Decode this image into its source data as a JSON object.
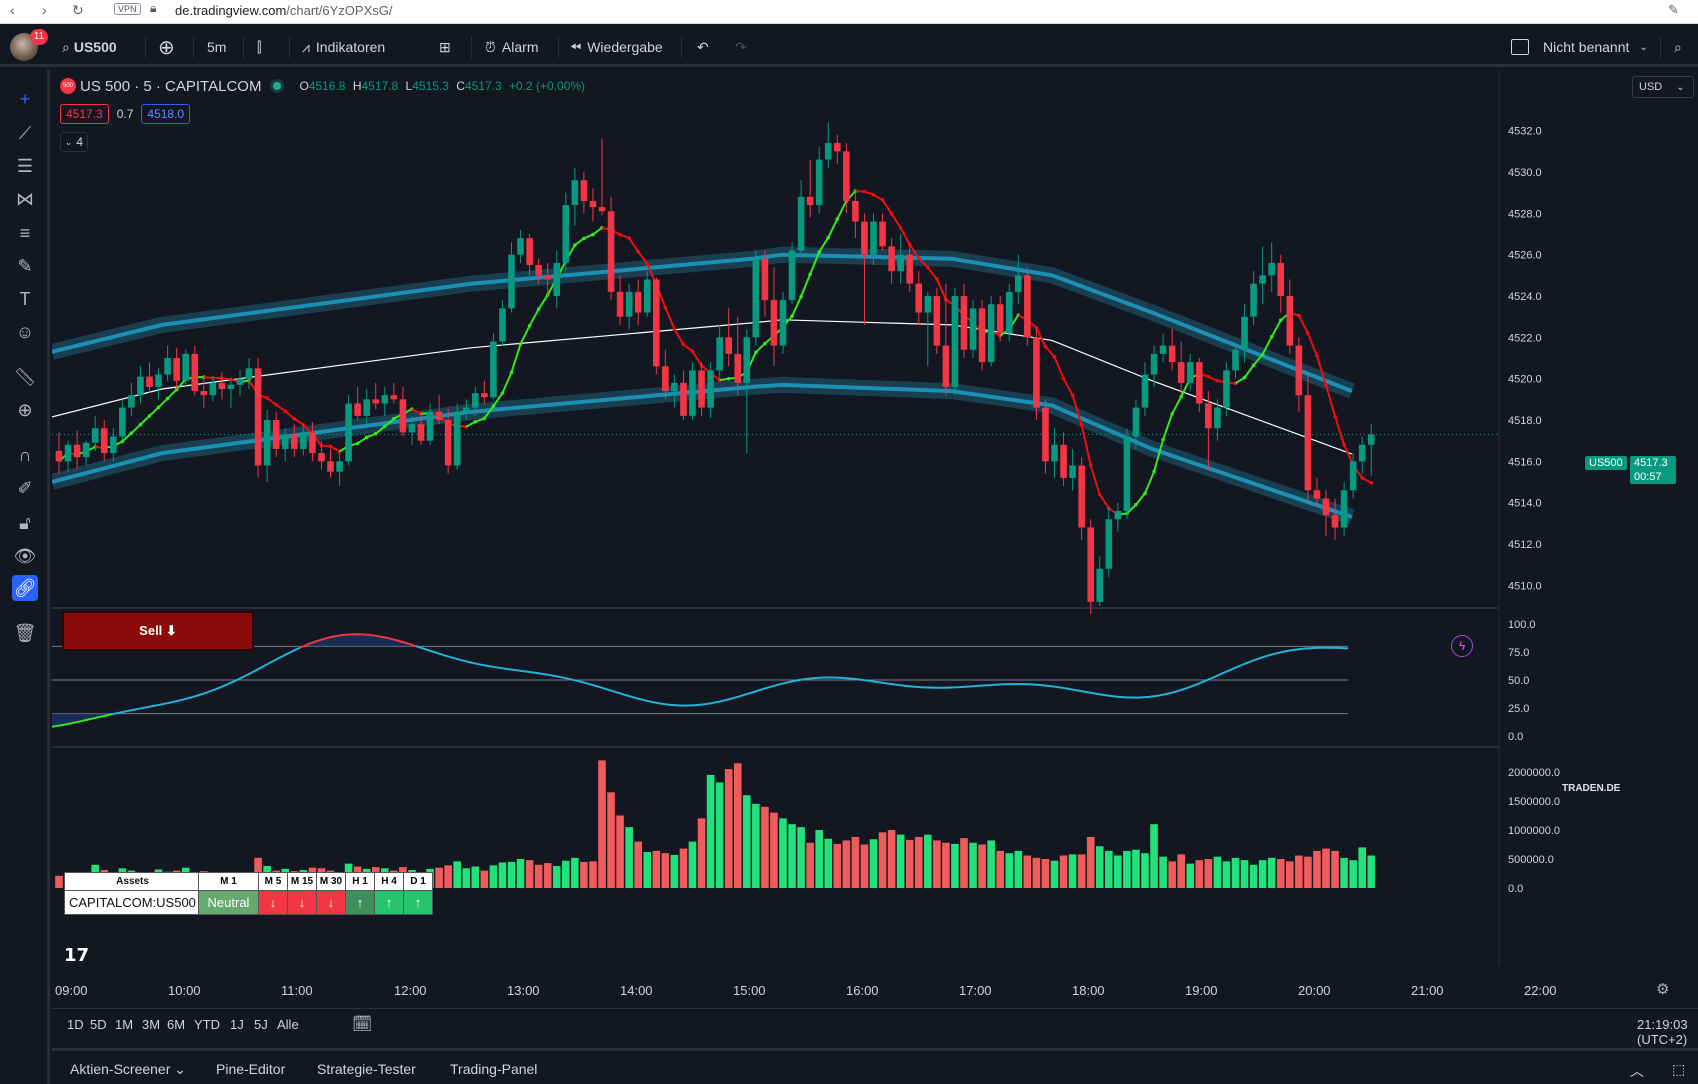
{
  "browser": {
    "url_host": "de.tradingview.com",
    "url_path": "/chart/6YzOPXsG/",
    "vpn_label": "VPN"
  },
  "toolbar": {
    "notifications": "11",
    "symbol": "US500",
    "interval": "5m",
    "indicators": "Indikatoren",
    "alarm": "Alarm",
    "replay": "Wiedergabe",
    "layout_name": "Nicht benannt"
  },
  "left_tools": [
    "crosshair-icon",
    "trend-line-icon",
    "horizontal-lines-icon",
    "pattern-icon",
    "fib-icon",
    "brush-icon",
    "text-icon",
    "emoji-icon",
    "ruler-icon",
    "zoom-icon",
    "magnet-icon",
    "lock-drawing-icon",
    "lock-icon",
    "eye-icon",
    "link-icon",
    "trash-icon"
  ],
  "legend": {
    "logo_text": "500",
    "title": "US 500 · 5 · CAPITALCOM",
    "o_label": "O",
    "o": "4516.8",
    "h_label": "H",
    "h": "4517.8",
    "l_label": "L",
    "l": "4515.3",
    "c_label": "C",
    "c": "4517.3",
    "change": "+0.2 (+0.00%)",
    "bid": "4517.3",
    "spread": "0.7",
    "ask": "4518.0",
    "collapse_count": "4",
    "currency": "USD"
  },
  "sell_button": "Sell ⬇",
  "price_tag": {
    "symbol": "US500",
    "price": "4517.3",
    "countdown": "00:57"
  },
  "price_axis": [
    "4532.0",
    "4530.0",
    "4528.0",
    "4526.0",
    "4524.0",
    "4522.0",
    "4520.0",
    "4518.0",
    "4516.0",
    "4514.0",
    "4512.0",
    "4510.0"
  ],
  "osc_axis": [
    "100.0",
    "75.0",
    "50.0",
    "25.0",
    "0.0"
  ],
  "vol_axis": [
    "2000000.0",
    "1500000.0",
    "1000000.0",
    "500000.0",
    "0.0"
  ],
  "osc_brand": "TRADEN.DE",
  "mtf_table": {
    "header": [
      "Assets",
      "M 1",
      "M 5",
      "M 15",
      "M 30",
      "H 1",
      "H 4",
      "D 1"
    ],
    "asset": "CAPITALCOM:US500",
    "m1": "Neutral",
    "arrows": [
      "↓",
      "↓",
      "↓",
      "↑",
      "↑",
      "↑"
    ]
  },
  "time_axis": [
    "09:00",
    "10:00",
    "11:00",
    "12:00",
    "13:00",
    "14:00",
    "15:00",
    "16:00",
    "17:00",
    "18:00",
    "19:00",
    "20:00",
    "21:00",
    "22:00"
  ],
  "ranges": [
    "1D",
    "5D",
    "1M",
    "3M",
    "6M",
    "YTD",
    "1J",
    "5J",
    "Alle"
  ],
  "clock": "21:19:03 (UTC+2)",
  "bottom_panels": [
    "Aktien-Screener",
    "Pine-Editor",
    "Strategie-Tester",
    "Trading-Panel"
  ],
  "chart_data": {
    "type": "candlestick",
    "price_range": [
      4509.0,
      4533.0
    ],
    "candles": [
      [
        4516.5,
        4517.4,
        4515.4,
        4516.0
      ],
      [
        4516.0,
        4517.0,
        4515.5,
        4516.8
      ],
      [
        4516.8,
        4517.5,
        4515.6,
        4516.2
      ],
      [
        4516.2,
        4517.0,
        4515.8,
        4516.9
      ],
      [
        4516.9,
        4518.2,
        4516.5,
        4517.6
      ],
      [
        4517.6,
        4518.0,
        4516.0,
        4516.4
      ],
      [
        4516.4,
        4517.6,
        4516.0,
        4517.2
      ],
      [
        4517.2,
        4519.0,
        4517.0,
        4518.6
      ],
      [
        4518.6,
        4519.8,
        4518.2,
        4519.2
      ],
      [
        4519.2,
        4520.6,
        4518.8,
        4520.1
      ],
      [
        4520.1,
        4520.8,
        4519.3,
        4519.6
      ],
      [
        4519.6,
        4520.5,
        4519.0,
        4520.2
      ],
      [
        4520.2,
        4521.6,
        4519.9,
        4521.0
      ],
      [
        4521.0,
        4521.5,
        4519.5,
        4519.9
      ],
      [
        4519.9,
        4521.4,
        4519.6,
        4521.2
      ],
      [
        4521.2,
        4521.6,
        4519.2,
        4519.4
      ],
      [
        4519.4,
        4520.0,
        4518.6,
        4519.2
      ],
      [
        4519.2,
        4520.1,
        4518.9,
        4519.8
      ],
      [
        4519.8,
        4520.3,
        4519.0,
        4519.5
      ],
      [
        4519.5,
        4520.0,
        4518.6,
        4519.7
      ],
      [
        4519.7,
        4520.4,
        4519.2,
        4520.0
      ],
      [
        4520.0,
        4521.0,
        4519.5,
        4520.5
      ],
      [
        4520.5,
        4521.0,
        4515.2,
        4515.8
      ],
      [
        4515.8,
        4518.5,
        4515.0,
        4518.0
      ],
      [
        4518.0,
        4518.4,
        4516.2,
        4516.6
      ],
      [
        4516.6,
        4517.6,
        4516.0,
        4517.3
      ],
      [
        4517.3,
        4517.8,
        4516.2,
        4516.6
      ],
      [
        4516.6,
        4517.8,
        4516.3,
        4517.4
      ],
      [
        4517.4,
        4517.9,
        4516.0,
        4516.4
      ],
      [
        4516.4,
        4517.0,
        4515.6,
        4516.0
      ],
      [
        4516.0,
        4516.6,
        4515.2,
        4515.5
      ],
      [
        4515.5,
        4516.4,
        4514.8,
        4516.0
      ],
      [
        4516.0,
        4519.2,
        4515.8,
        4518.8
      ],
      [
        4518.8,
        4519.6,
        4518.0,
        4518.2
      ],
      [
        4518.2,
        4519.5,
        4517.8,
        4519.0
      ],
      [
        4519.0,
        4519.8,
        4518.5,
        4518.8
      ],
      [
        4518.8,
        4519.6,
        4518.2,
        4519.2
      ],
      [
        4519.2,
        4519.8,
        4518.8,
        4519.0
      ],
      [
        4519.0,
        4519.6,
        4517.2,
        4517.4
      ],
      [
        4517.4,
        4518.2,
        4516.8,
        4517.8
      ],
      [
        4517.8,
        4518.3,
        4516.8,
        4517.0
      ],
      [
        4517.0,
        4518.8,
        4516.8,
        4518.4
      ],
      [
        4518.4,
        4519.2,
        4517.8,
        4518.0
      ],
      [
        4518.0,
        4518.6,
        4515.4,
        4515.8
      ],
      [
        4515.8,
        4518.8,
        4515.6,
        4518.4
      ],
      [
        4518.4,
        4519.0,
        4518.0,
        4518.6
      ],
      [
        4518.6,
        4519.6,
        4518.2,
        4519.3
      ],
      [
        4519.3,
        4519.9,
        4518.8,
        4519.1
      ],
      [
        4519.1,
        4522.2,
        4519.0,
        4521.8
      ],
      [
        4521.8,
        4523.8,
        4521.6,
        4523.4
      ],
      [
        4523.4,
        4526.6,
        4523.2,
        4526.0
      ],
      [
        4526.0,
        4527.2,
        4525.6,
        4526.8
      ],
      [
        4526.8,
        4527.0,
        4525.0,
        4525.5
      ],
      [
        4525.5,
        4525.8,
        4524.6,
        4525.0
      ],
      [
        4525.0,
        4525.6,
        4524.0,
        4524.8
      ],
      [
        4524.0,
        4526.2,
        4523.4,
        4525.6
      ],
      [
        4525.6,
        4529.0,
        4525.2,
        4528.4
      ],
      [
        4528.4,
        4530.2,
        4527.4,
        4529.6
      ],
      [
        4529.6,
        4530.0,
        4528.0,
        4528.6
      ],
      [
        4528.6,
        4529.2,
        4527.6,
        4528.3
      ],
      [
        4528.3,
        4531.6,
        4527.9,
        4528.1
      ],
      [
        4528.1,
        4528.8,
        4523.8,
        4524.2
      ],
      [
        4524.2,
        4525.0,
        4522.6,
        4523.0
      ],
      [
        4523.0,
        4524.6,
        4522.4,
        4524.2
      ],
      [
        4524.2,
        4524.8,
        4522.6,
        4523.2
      ],
      [
        4523.2,
        4525.2,
        4523.0,
        4524.8
      ],
      [
        4524.8,
        4524.9,
        4520.2,
        4520.6
      ],
      [
        4520.6,
        4521.4,
        4519.0,
        4519.4
      ],
      [
        4519.4,
        4520.2,
        4518.6,
        4519.8
      ],
      [
        4519.8,
        4520.4,
        4518.0,
        4518.2
      ],
      [
        4518.2,
        4520.8,
        4518.0,
        4520.4
      ],
      [
        4520.4,
        4520.8,
        4518.2,
        4518.6
      ],
      [
        4518.6,
        4520.8,
        4518.1,
        4520.4
      ],
      [
        4520.4,
        4522.6,
        4520.0,
        4522.0
      ],
      [
        4522.0,
        4523.4,
        4520.6,
        4521.2
      ],
      [
        4521.2,
        4523.0,
        4519.2,
        4519.8
      ],
      [
        4519.8,
        4522.4,
        4516.4,
        4522.0
      ],
      [
        4522.0,
        4526.2,
        4521.6,
        4525.8
      ],
      [
        4525.8,
        4526.2,
        4523.0,
        4523.8
      ],
      [
        4523.8,
        4525.4,
        4520.6,
        4521.6
      ],
      [
        4521.6,
        4524.2,
        4521.2,
        4523.8
      ],
      [
        4523.8,
        4526.6,
        4523.6,
        4526.2
      ],
      [
        4526.2,
        4529.6,
        4526.0,
        4528.8
      ],
      [
        4528.8,
        4530.6,
        4527.8,
        4528.4
      ],
      [
        4528.4,
        4531.2,
        4528.0,
        4530.6
      ],
      [
        4530.6,
        4532.4,
        4530.2,
        4531.4
      ],
      [
        4531.4,
        4531.8,
        4530.4,
        4531.0
      ],
      [
        4531.0,
        4531.4,
        4528.0,
        4528.6
      ],
      [
        4528.6,
        4529.0,
        4526.8,
        4527.6
      ],
      [
        4527.6,
        4528.0,
        4522.6,
        4526.0
      ],
      [
        4526.0,
        4528.0,
        4525.5,
        4527.6
      ],
      [
        4527.6,
        4528.0,
        4526.2,
        4526.4
      ],
      [
        4526.4,
        4526.8,
        4524.6,
        4525.2
      ],
      [
        4525.2,
        4527.0,
        4524.6,
        4526.0
      ],
      [
        4526.0,
        4526.4,
        4524.2,
        4524.6
      ],
      [
        4524.6,
        4525.2,
        4522.6,
        4523.2
      ],
      [
        4523.2,
        4524.2,
        4520.6,
        4524.0
      ],
      [
        4524.0,
        4524.4,
        4521.2,
        4521.6
      ],
      [
        4521.6,
        4524.6,
        4519.2,
        4519.6
      ],
      [
        4519.6,
        4524.4,
        4519.2,
        4524.0
      ],
      [
        4524.0,
        4524.6,
        4521.0,
        4521.4
      ],
      [
        4521.4,
        4523.8,
        4521.0,
        4523.4
      ],
      [
        4523.4,
        4523.8,
        4520.4,
        4520.8
      ],
      [
        4520.8,
        4524.0,
        4520.6,
        4523.6
      ],
      [
        4523.6,
        4524.0,
        4521.8,
        4522.2
      ],
      [
        4522.2,
        4524.6,
        4521.8,
        4524.2
      ],
      [
        4524.2,
        4526.0,
        4523.6,
        4525.0
      ],
      [
        4525.0,
        4525.4,
        4521.6,
        4522.0
      ],
      [
        4522.0,
        4522.4,
        4518.0,
        4518.6
      ],
      [
        4518.6,
        4519.0,
        4515.4,
        4516.0
      ],
      [
        4516.0,
        4517.6,
        4515.2,
        4516.8
      ],
      [
        4516.8,
        4517.4,
        4514.8,
        4515.2
      ],
      [
        4515.2,
        4516.6,
        4514.6,
        4515.8
      ],
      [
        4515.8,
        4516.2,
        4512.2,
        4512.8
      ],
      [
        4512.8,
        4513.2,
        4508.6,
        4509.2
      ],
      [
        4509.2,
        4511.4,
        4509.0,
        4510.8
      ],
      [
        4510.8,
        4513.8,
        4510.4,
        4513.2
      ],
      [
        4513.2,
        4514.0,
        4512.6,
        4513.6
      ],
      [
        4513.6,
        4517.6,
        4513.2,
        4517.2
      ],
      [
        4517.2,
        4519.0,
        4516.6,
        4518.6
      ],
      [
        4518.6,
        4520.8,
        4518.2,
        4520.2
      ],
      [
        4520.2,
        4521.6,
        4519.6,
        4521.2
      ],
      [
        4521.2,
        4522.2,
        4520.8,
        4521.6
      ],
      [
        4521.6,
        4522.4,
        4520.4,
        4520.8
      ],
      [
        4520.8,
        4521.8,
        4519.2,
        4519.8
      ],
      [
        4519.8,
        4521.2,
        4519.4,
        4520.8
      ],
      [
        4520.8,
        4521.0,
        4518.4,
        4518.8
      ],
      [
        4518.8,
        4519.4,
        4515.6,
        4517.6
      ],
      [
        4517.6,
        4519.0,
        4517.0,
        4518.6
      ],
      [
        4518.6,
        4520.8,
        4518.2,
        4520.4
      ],
      [
        4520.4,
        4521.6,
        4520.0,
        4521.4
      ],
      [
        4521.4,
        4523.6,
        4520.8,
        4523.0
      ],
      [
        4523.0,
        4525.2,
        4522.6,
        4524.6
      ],
      [
        4524.6,
        4526.4,
        4523.6,
        4525.0
      ],
      [
        4525.0,
        4526.6,
        4524.2,
        4525.6
      ],
      [
        4525.6,
        4526.0,
        4523.2,
        4524.0
      ],
      [
        4524.0,
        4524.8,
        4521.2,
        4521.6
      ],
      [
        4521.6,
        4522.0,
        4518.4,
        4519.2
      ],
      [
        4519.2,
        4520.2,
        4514.0,
        4514.6
      ],
      [
        4514.6,
        4515.2,
        4513.8,
        4514.2
      ],
      [
        4514.2,
        4514.6,
        4512.4,
        4513.4
      ],
      [
        4513.4,
        4514.2,
        4512.2,
        4512.8
      ],
      [
        4512.8,
        4515.0,
        4512.4,
        4514.6
      ],
      [
        4514.6,
        4516.4,
        4514.2,
        4516.0
      ],
      [
        4516.0,
        4517.2,
        4515.4,
        4516.8
      ],
      [
        4516.8,
        4517.8,
        4515.3,
        4517.3
      ]
    ],
    "volume": [
      210,
      190,
      230,
      180,
      400,
      310,
      260,
      340,
      300,
      250,
      270,
      320,
      280,
      300,
      350,
      260,
      290,
      240,
      210,
      260,
      240,
      270,
      520,
      380,
      300,
      330,
      290,
      310,
      350,
      340,
      300,
      260,
      420,
      370,
      330,
      360,
      340,
      300,
      360,
      310,
      270,
      330,
      350,
      390,
      460,
      340,
      370,
      300,
      390,
      440,
      450,
      500,
      480,
      400,
      430,
      380,
      470,
      520,
      450,
      460,
      2200,
      1650,
      1250,
      1050,
      800,
      620,
      640,
      600,
      570,
      680,
      800,
      1200,
      1950,
      1820,
      2050,
      2150,
      1600,
      1450,
      1400,
      1300,
      1200,
      1100,
      1050,
      780,
      1000,
      850,
      760,
      820,
      880,
      750,
      840,
      960,
      1000,
      920,
      830,
      880,
      920,
      820,
      780,
      760,
      860,
      780,
      750,
      820,
      640,
      600,
      640,
      560,
      520,
      500,
      470,
      560,
      580,
      580,
      880,
      720,
      640,
      560,
      640,
      660,
      600,
      1100,
      540,
      460,
      580,
      420,
      480,
      500,
      540,
      460,
      520,
      480,
      400,
      480,
      520,
      500,
      460,
      560,
      540,
      640,
      680,
      640,
      520,
      480,
      700,
      560,
      500,
      480
    ],
    "vol_range": [
      0,
      2000000
    ]
  }
}
